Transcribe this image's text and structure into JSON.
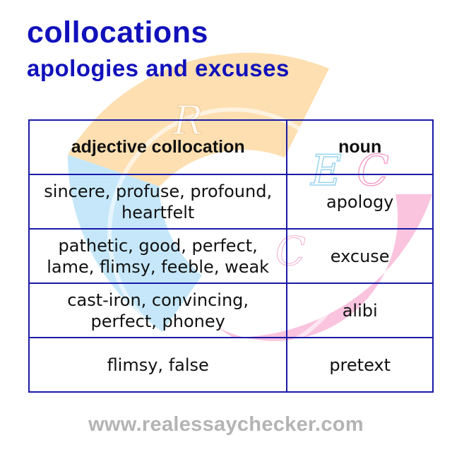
{
  "title": "collocations",
  "subtitle": "apologies and excuses",
  "table": {
    "headers": [
      "adjective collocation",
      "noun"
    ],
    "rows": [
      {
        "adjectives_line1": "sincere, profuse, profound,",
        "adjectives_line2": "heartfelt",
        "noun": "apology"
      },
      {
        "adjectives_line1": "pathetic, good, perfect,",
        "adjectives_line2": "lame, flimsy, feeble, weak",
        "noun": "excuse"
      },
      {
        "adjectives_line1": "cast-iron, convincing,",
        "adjectives_line2": "perfect, phoney",
        "noun": "alibi"
      },
      {
        "adjectives_line1": "flimsy, false",
        "adjectives_line2": "",
        "noun": "pretext"
      }
    ]
  },
  "watermark": {
    "letters": [
      "R",
      "E",
      "C",
      "C"
    ],
    "colors": {
      "orange": "#fdd9a3",
      "blue": "#bfe4f8",
      "pink": "#f9b8d8"
    }
  },
  "footer": {
    "url": "www.realessaychecker.com"
  },
  "colors": {
    "title": "#1111bb",
    "border": "#1a1aa8",
    "url": "#b4b4b4"
  }
}
